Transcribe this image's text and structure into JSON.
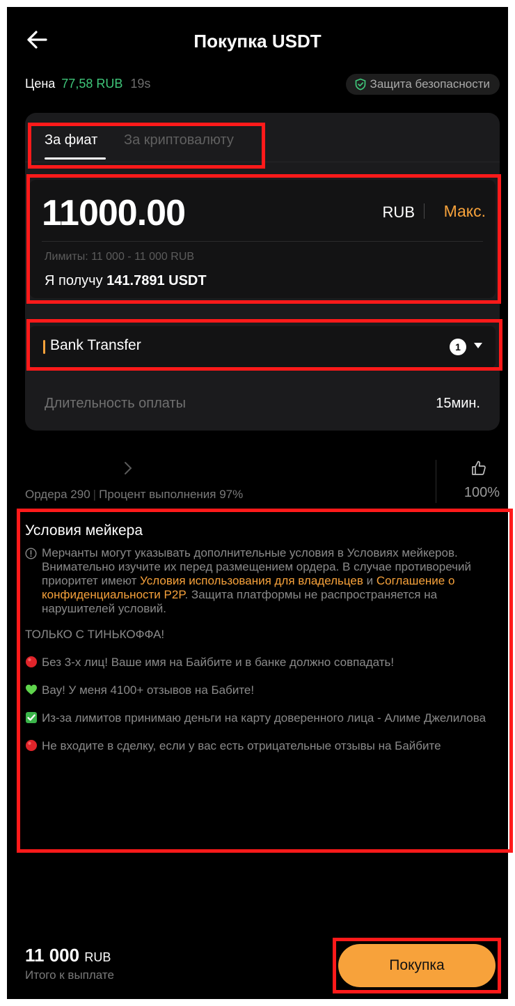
{
  "header": {
    "title": "Покупка USDT",
    "back_icon": "arrow-left-icon"
  },
  "price": {
    "label": "Цена",
    "value": "77,58 RUB",
    "timer": "19s",
    "value_color": "#3fc77a"
  },
  "security": {
    "label": "Защита безопасности",
    "icon": "shield-check-icon"
  },
  "tabs": [
    {
      "label": "За фиат",
      "active": true
    },
    {
      "label": "За криптовалюту",
      "active": false
    }
  ],
  "amount": {
    "value": "11000.00",
    "currency": "RUB",
    "max_label": "Макс.",
    "limits": "Лимиты: 11 000 - 11 000 RUB",
    "receive_prefix": "Я получу",
    "receive_value": "141.7891 USDT"
  },
  "payment": {
    "method": "Bank Transfer",
    "count": "1",
    "duration_label": "Длительность оплаты",
    "duration_value": "15мин."
  },
  "merchant": {
    "orders": "Ордера 290",
    "completion": "Процент выполнения 97%",
    "rating": "100%"
  },
  "terms": {
    "title": "Условия мейкера",
    "notice_part1": "Мерчанты могут указывать дополнительные условия в Условиях мейкеров. Внимательно изучите их перед размещением ордера. В случае противоречий приоритет имеют",
    "link1": "Условия использования для владельцев",
    "notice_and": "и",
    "link2": "Соглашение о конфиденциальности P2P",
    "notice_part2": ". Защита платформы не распространяется на нарушителей условий.",
    "lines": [
      "ТОЛЬКО С ТИНЬКОФФА!",
      "Без 3-х лиц! Ваше имя на Байбите и в банке должно  совпадать!",
      "Вау! У меня 4100+ отзывов на Бабите!",
      "Из-за лимитов принимаю деньги на карту доверенного лица - Алиме Джелилова",
      "Не входите в сделку, если у вас есть отрицательные отзывы на Байбите"
    ],
    "accent_color": "#f7a23b"
  },
  "footer": {
    "total": "11 000",
    "total_currency": "RUB",
    "total_label": "Итого к выплате",
    "buy_label": "Покупка",
    "buy_color": "#f7a23b"
  }
}
